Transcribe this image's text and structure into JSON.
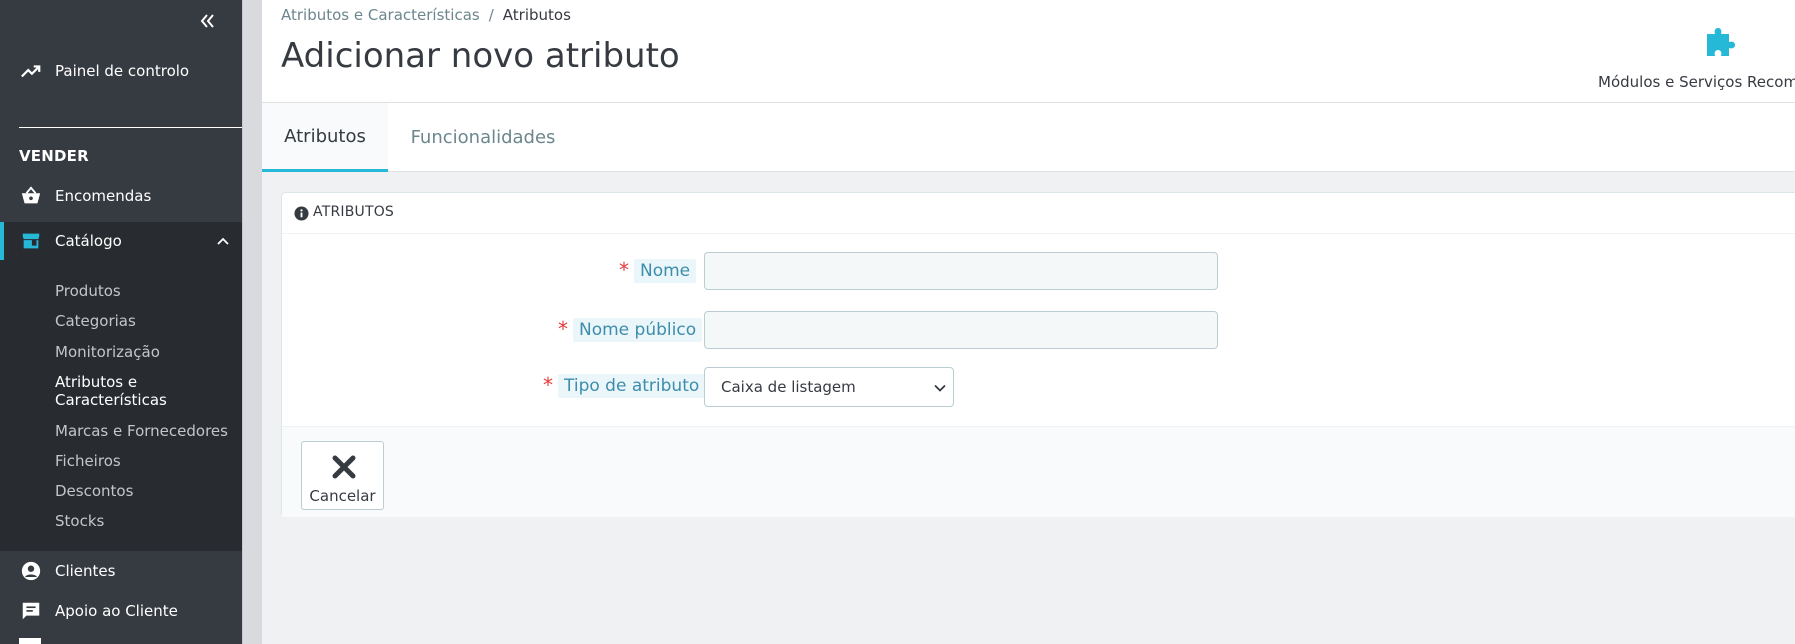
{
  "sidebar": {
    "collapse_icon": "double-chevron-left-icon",
    "dashboard_label": "Painel de controlo",
    "section_title": "VENDER",
    "items": [
      {
        "label": "Encomendas",
        "icon": "basket-icon"
      },
      {
        "label": "Catálogo",
        "icon": "store-icon",
        "active": true
      },
      {
        "label": "Clientes",
        "icon": "account-circle-icon"
      },
      {
        "label": "Apoio ao Cliente",
        "icon": "chat-icon"
      }
    ],
    "catalog_sub": [
      "Produtos",
      "Categorias",
      "Monitorização",
      "Atributos e Características",
      "Marcas e Fornecedores",
      "Ficheiros",
      "Descontos",
      "Stocks"
    ]
  },
  "header": {
    "breadcrumb": [
      "Atributos e Características",
      "Atributos"
    ],
    "breadcrumb_sep": "/",
    "title": "Adicionar novo atributo",
    "modules_label": "Módulos e Serviços Recomen"
  },
  "tabs": [
    {
      "label": "Atributos",
      "active": true
    },
    {
      "label": "Funcionalidades",
      "active": false
    }
  ],
  "panel": {
    "title": "ATRIBUTOS",
    "fields": {
      "name": {
        "label": "Nome",
        "value": ""
      },
      "public_name": {
        "label": "Nome público",
        "value": ""
      },
      "type": {
        "label": "Tipo de atributo",
        "selected": "Caixa de listagem"
      }
    },
    "required_mark": "*",
    "cancel_label": "Cancelar"
  },
  "colors": {
    "sidebar_bg": "#363a41",
    "accent": "#25b9d7",
    "label_blue": "#3d8dab",
    "required_red": "#e43a3a"
  }
}
